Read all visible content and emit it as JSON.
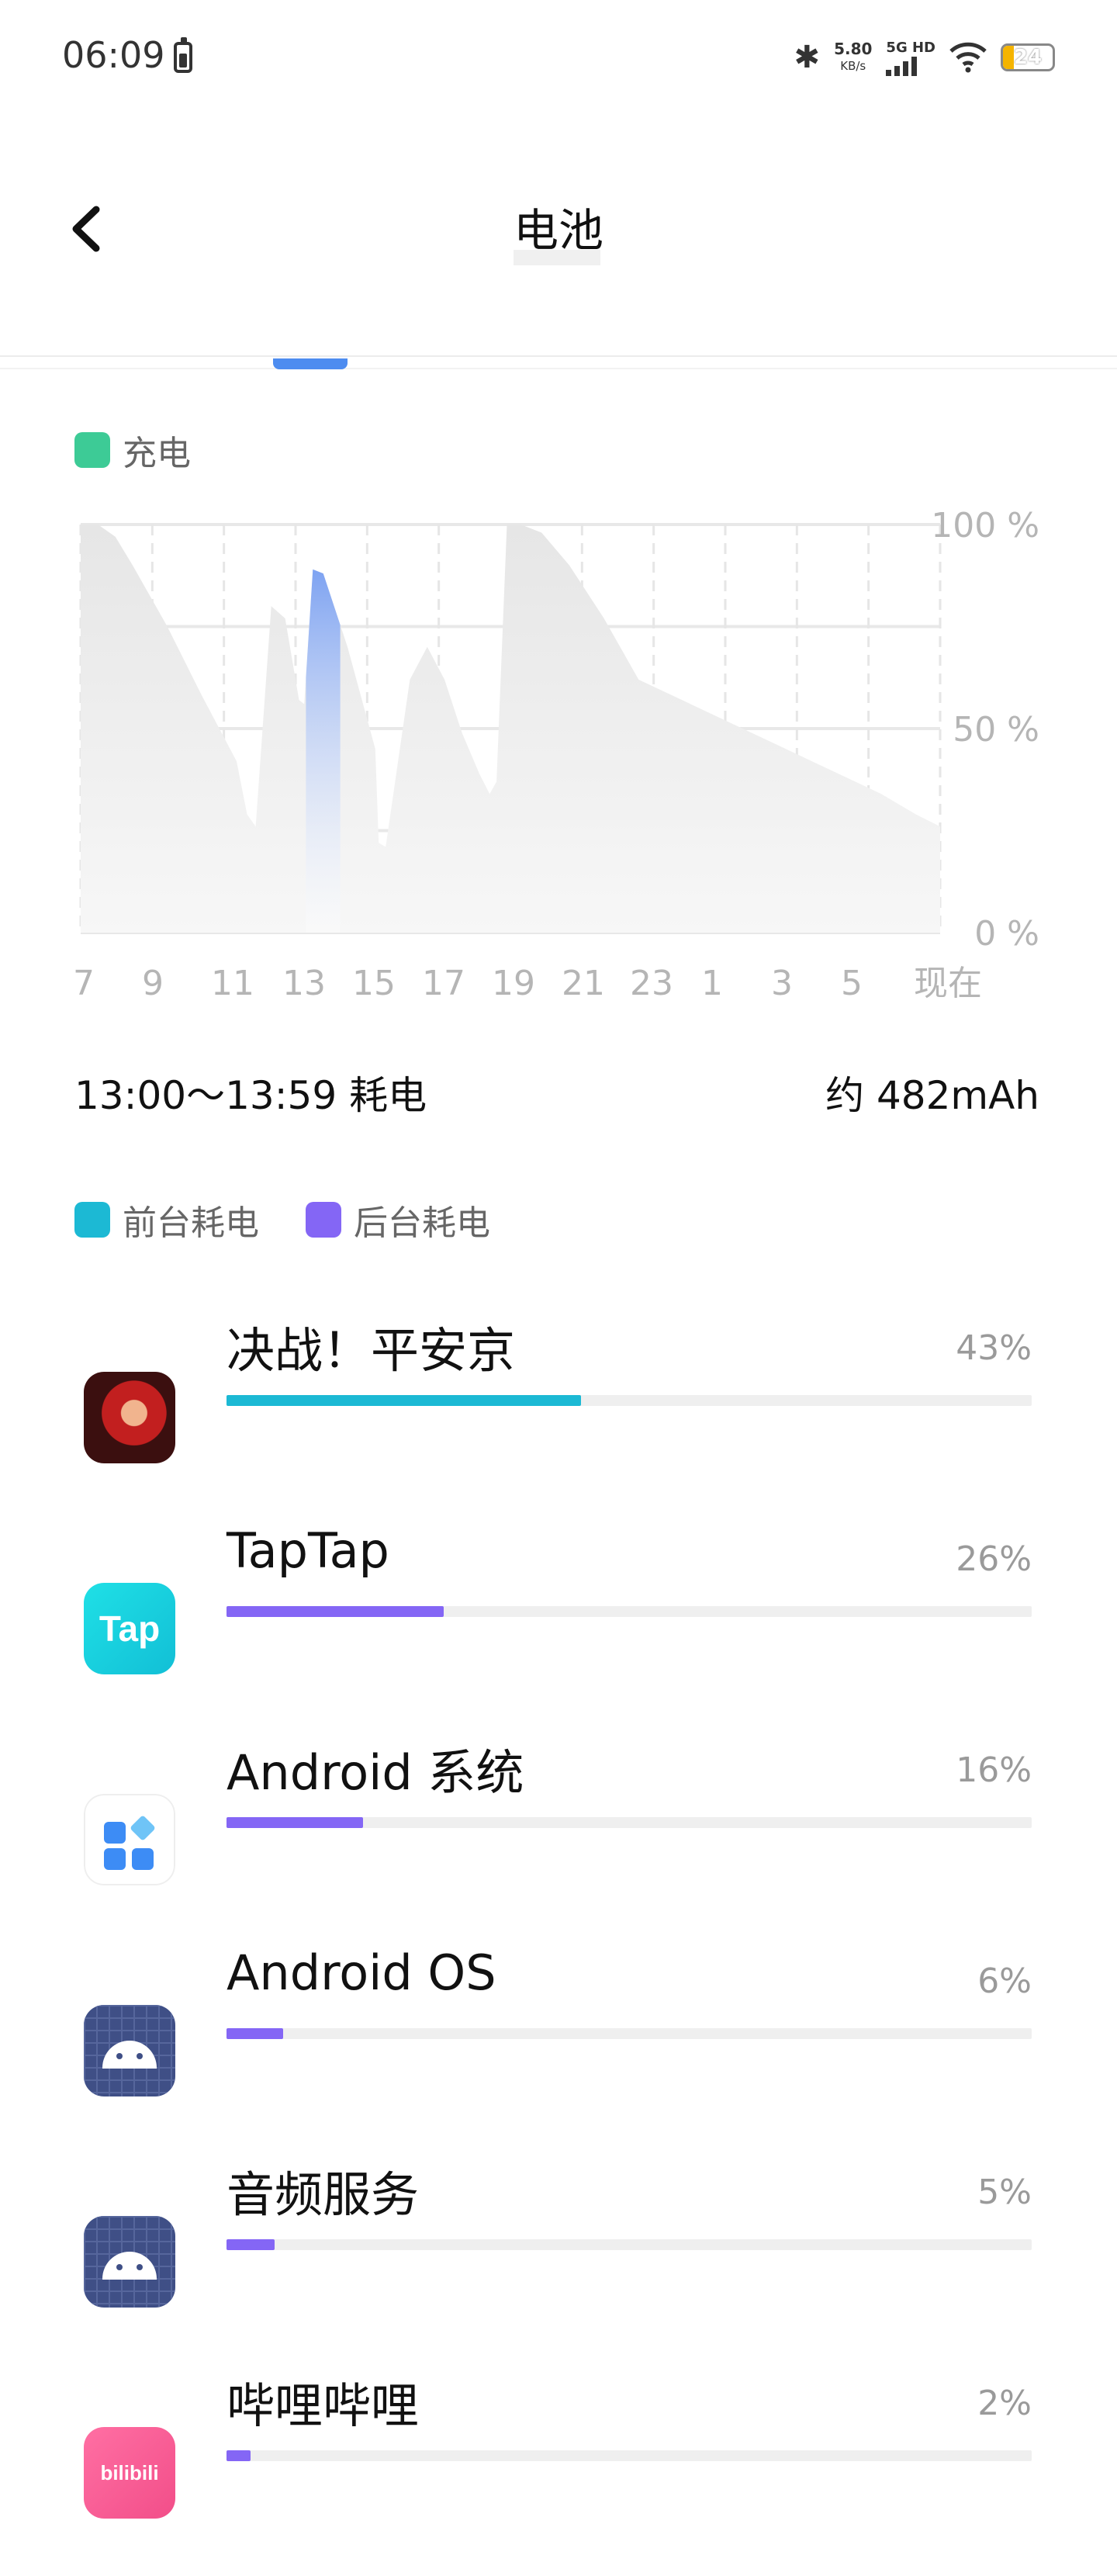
{
  "status_bar": {
    "time": "06:09",
    "network_speed": "5.80",
    "network_speed_unit": "KB/s",
    "signal_label": "5G HD",
    "battery_level": "24"
  },
  "header": {
    "title": "电池"
  },
  "legend_charge": {
    "label": "充电",
    "color": "#3dcb96"
  },
  "chart_data": {
    "type": "area",
    "x_tick_labels": [
      "7",
      "9",
      "11",
      "13",
      "15",
      "17",
      "19",
      "21",
      "23",
      "1",
      "3",
      "5",
      "现在"
    ],
    "y_tick_labels": [
      "100 %",
      "50 %",
      "0 %"
    ],
    "ylim": [
      0,
      100
    ],
    "grid": true,
    "series": [
      {
        "hours": [
          6.5,
          7.0,
          7.5,
          8.0,
          9.0,
          10.0,
          11.0,
          11.3,
          11.55,
          12.0,
          12.4,
          12.8,
          12.95,
          13.2,
          13.5,
          14.2,
          15.0,
          15.1,
          15.3,
          16.0,
          16.5,
          17.0,
          17.5,
          18.0,
          18.3,
          18.5,
          18.8,
          19.2,
          19.8,
          20.6,
          21.6,
          22.6,
          23.6,
          24.6,
          25.6,
          26.6,
          27.6,
          28.6,
          29.6,
          30.6,
          31.3
        ],
        "battery_percent": [
          100,
          100,
          97,
          90,
          75,
          58,
          42,
          29,
          26,
          80,
          77,
          57,
          56,
          89,
          88,
          70,
          45,
          22,
          21,
          62,
          70,
          62,
          49,
          39,
          34,
          37,
          100,
          100,
          98,
          90,
          77,
          62,
          58,
          54,
          50,
          46,
          42,
          38,
          34,
          29,
          26
        ]
      }
    ],
    "highlight": {
      "start_hour": 13.0,
      "end_hour": 13.99,
      "color": "#7ea3f2"
    }
  },
  "usage_summary": {
    "range_label": "13:00～13:59 耗电",
    "value": "约 482mAh"
  },
  "legend_usage": {
    "foreground_label": "前台耗电",
    "foreground_color": "#1cb9d4",
    "background_label": "后台耗电",
    "background_color": "#8466f5"
  },
  "apps": [
    {
      "name": "决战！平安京",
      "percent_label": "43%",
      "fraction": 0.44,
      "bar_color": "#1cb9d4",
      "icon": "game-hero-icon"
    },
    {
      "name": "TapTap",
      "percent_label": "26%",
      "fraction": 0.27,
      "bar_color": "#8466f5",
      "icon": "taptap-icon",
      "icon_text": "Tap"
    },
    {
      "name": "Android 系统",
      "percent_label": "16%",
      "fraction": 0.17,
      "bar_color": "#8466f5",
      "icon": "android-system-icon"
    },
    {
      "name": "Android OS",
      "percent_label": "6%",
      "fraction": 0.07,
      "bar_color": "#8466f5",
      "icon": "android-robot-icon"
    },
    {
      "name": "音频服务",
      "percent_label": "5%",
      "fraction": 0.06,
      "bar_color": "#8466f5",
      "icon": "android-robot-icon"
    },
    {
      "name": "哔哩哔哩",
      "percent_label": "2%",
      "fraction": 0.03,
      "bar_color": "#8466f5",
      "icon": "bilibili-icon",
      "icon_text": "bilibili"
    }
  ]
}
